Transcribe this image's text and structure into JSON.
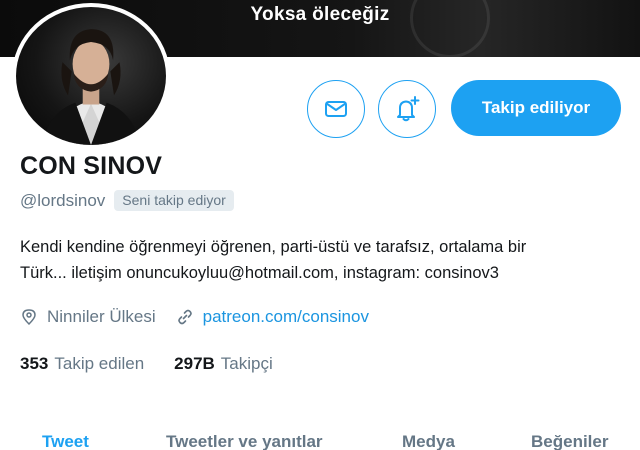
{
  "banner": {
    "title": "Yoksa öleceğiz"
  },
  "profile": {
    "display_name": "CON SINOV",
    "handle": "@lordsinov",
    "follows_you_badge": "Seni takip ediyor",
    "bio_line1": "Kendi kendine öğrenmeyi öğrenen, parti-üstü ve tarafsız, ortalama bir",
    "bio_line2": "Türk... iletişim onuncukoyluu@hotmail.com, instagram: consinov3",
    "location": "Ninniler Ülkesi",
    "website": "patreon.com/consinov"
  },
  "actions": {
    "follow_label": "Takip ediliyor",
    "message_icon": "envelope-icon",
    "notify_icon": "bell-plus-icon"
  },
  "stats": {
    "following_count": "353",
    "following_label": "Takip edilen",
    "followers_count": "297B",
    "followers_label": "Takipçi"
  },
  "tabs": {
    "tweets": "Tweet",
    "replies": "Tweetler ve yanıtlar",
    "media": "Medya",
    "likes": "Beğeniler"
  },
  "colors": {
    "accent": "#1da1f2",
    "secondary_text": "#657786",
    "primary_text": "#14171a",
    "link": "#1b95e0"
  }
}
